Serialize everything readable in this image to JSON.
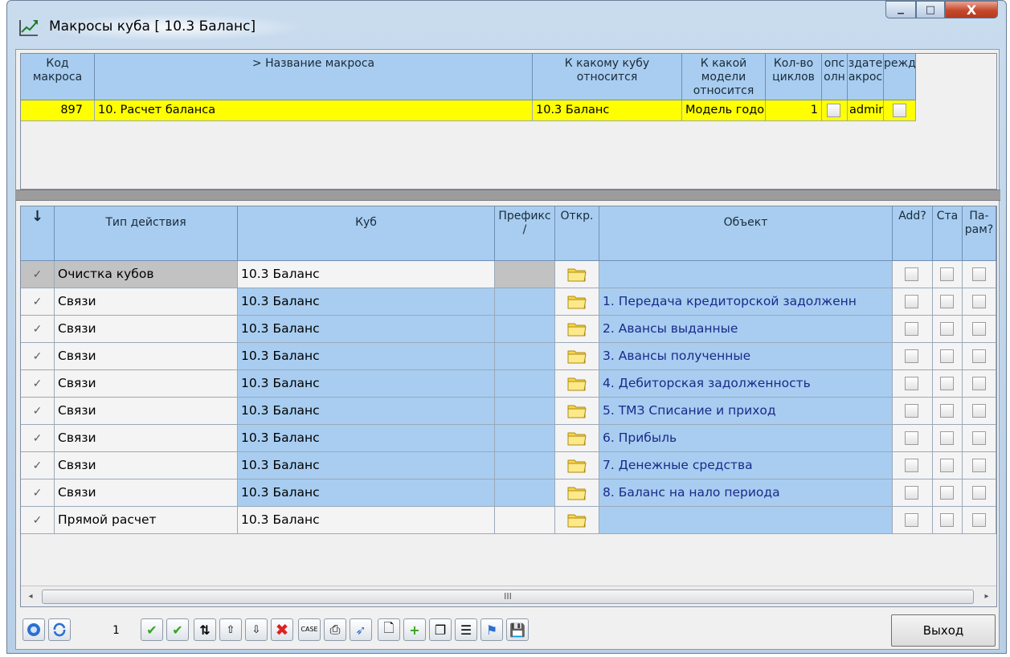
{
  "window": {
    "title": "Макросы куба [ 10.3 Баланс]",
    "minimize_glyph": "▁",
    "maximize_glyph": "□",
    "close_glyph": "X"
  },
  "top_grid": {
    "headers": {
      "code": "Код макроса",
      "name": "> Название макроса",
      "cube": "К какому кубу относится",
      "model": "К какой модели относится",
      "cycles": "Кол-во циклов",
      "c6": "опс олн",
      "c7": "здате акрос",
      "c8": "режд"
    },
    "row": {
      "code": "897",
      "name": "10. Расчет баланса",
      "cube": "10.3 Баланс",
      "model": "Модель годовог",
      "cycles": "1",
      "creator": "admin"
    }
  },
  "bottom_grid": {
    "headers": {
      "arrow": "↓",
      "action_type": "Тип действия",
      "cube": "Куб",
      "prefix": "Префикс /",
      "open": "Откр.",
      "object": "Объект",
      "add": "Add?",
      "sta": "Ста",
      "params": "Па-рам?"
    },
    "rows": [
      {
        "tick": "✓",
        "action": "Очистка кубов",
        "cube": "10.3 Баланс",
        "object": ""
      },
      {
        "tick": "✓",
        "action": "Связи",
        "cube": "10.3 Баланс",
        "object": "1. Передача кредиторской задолженн"
      },
      {
        "tick": "✓",
        "action": "Связи",
        "cube": "10.3 Баланс",
        "object": "2. Авансы выданные"
      },
      {
        "tick": "✓",
        "action": "Связи",
        "cube": "10.3 Баланс",
        "object": "3. Авансы полученные"
      },
      {
        "tick": "✓",
        "action": "Связи",
        "cube": "10.3 Баланс",
        "object": "4. Дебиторская задолженность"
      },
      {
        "tick": "✓",
        "action": "Связи",
        "cube": "10.3 Баланс",
        "object": "5. ТМЗ Списание и приход"
      },
      {
        "tick": "✓",
        "action": "Связи",
        "cube": "10.3 Баланс",
        "object": "6. Прибыль"
      },
      {
        "tick": "✓",
        "action": "Связи",
        "cube": "10.3 Баланс",
        "object": "7. Денежные средства"
      },
      {
        "tick": "✓",
        "action": "Связи",
        "cube": "10.3 Баланс",
        "object": "8. Баланс на нало периода"
      },
      {
        "tick": "✓",
        "action": "Прямой расчет",
        "cube": "10.3 Баланс",
        "object": ""
      }
    ],
    "scroll_thumb_grip": "III",
    "scroll_left": "◂",
    "scroll_right": "▸"
  },
  "toolbar": {
    "page_number": "1",
    "case_label": "CASE",
    "exit_label": "Выход"
  },
  "icons": {
    "help": "help-icon",
    "refresh": "refresh-icon",
    "check": "check-icon",
    "folder": "folder-icon"
  },
  "colors": {
    "header_blue": "#a8cdf0",
    "selected_row": "#ffff00",
    "object_text": "#1a2a8a"
  }
}
